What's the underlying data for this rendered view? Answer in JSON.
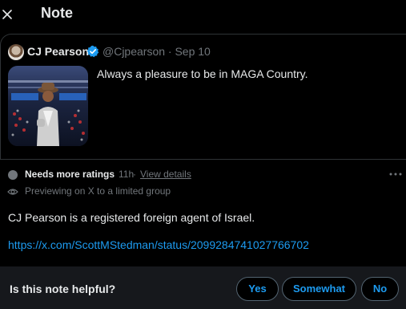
{
  "header": {
    "title": "Note"
  },
  "post": {
    "author_name": "CJ Pearson",
    "handle_and_date": "@Cjpearson · Sep 10",
    "text": "Always a pleasure to be in MAGA Country."
  },
  "note": {
    "status_title": "Needs more ratings",
    "time": "11h",
    "separator": "·",
    "view_details_label": "View details",
    "preview_text": "Previewing on X to a limited group",
    "body": "CJ Pearson is a registered foreign agent of Israel.",
    "link": "https://x.com/ScottMStedman/status/2099284741027766702"
  },
  "rating": {
    "question": "Is this note helpful?",
    "yes_label": "Yes",
    "somewhat_label": "Somewhat",
    "no_label": "No"
  },
  "colors": {
    "background": "#000000",
    "text_primary": "#e7e9ea",
    "text_secondary": "#71767b",
    "accent": "#1d9bf0",
    "border": "#2f3336",
    "rating_bar": "#16181c"
  },
  "icons": {
    "close": "close-icon",
    "verified": "verified-badge-icon",
    "status": "status-dot-icon",
    "more": "more-options-icon",
    "preview": "eye-icon"
  }
}
